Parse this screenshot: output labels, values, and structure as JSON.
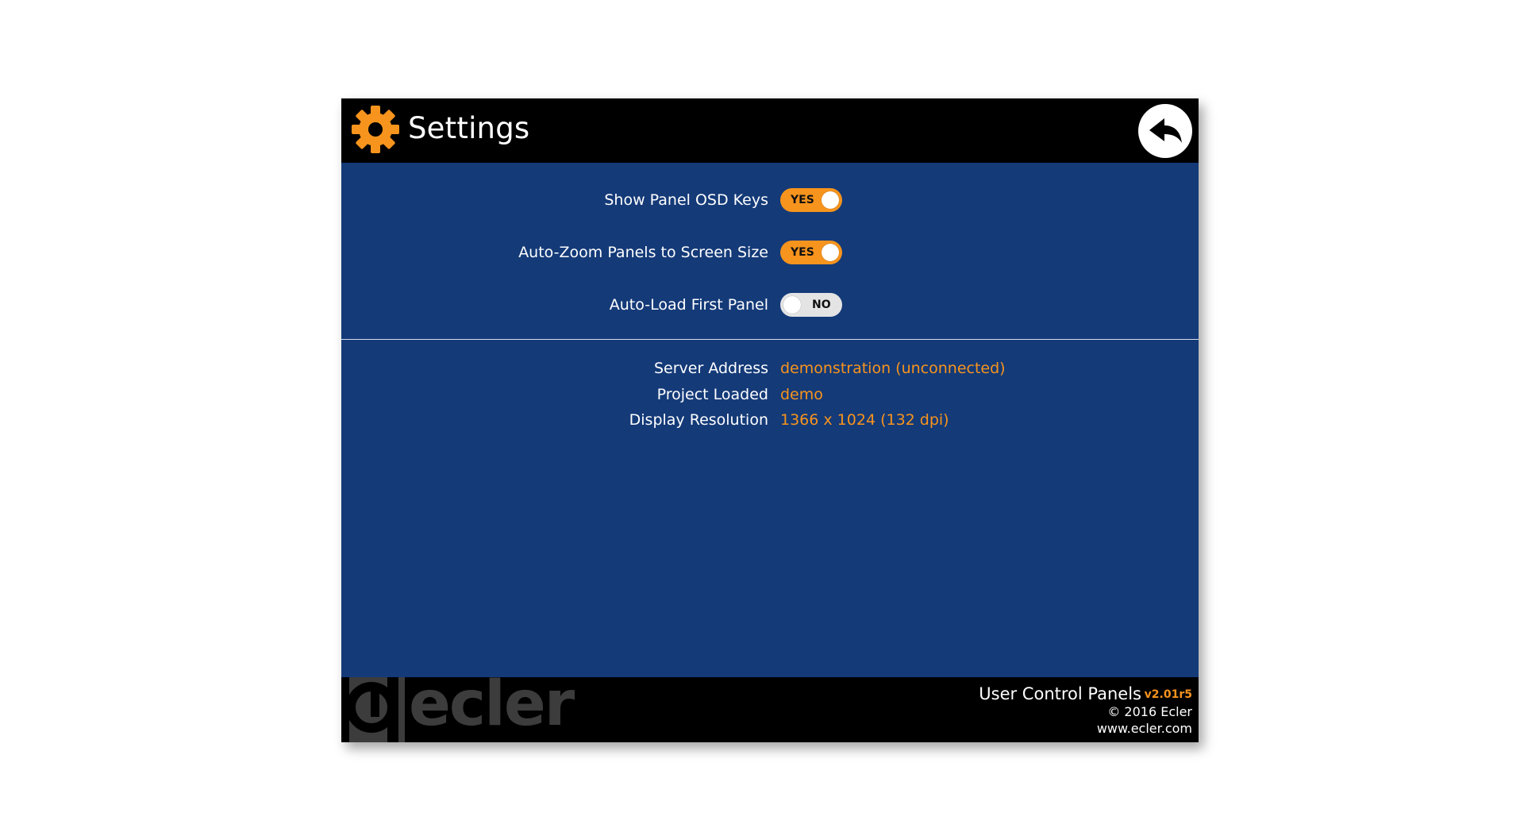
{
  "header": {
    "title": "Settings",
    "icon": "gear-icon",
    "back_icon": "back-arrow-icon"
  },
  "options": [
    {
      "label": "Show Panel OSD Keys",
      "state": "YES",
      "enabled": true
    },
    {
      "label": "Auto-Zoom Panels to Screen Size",
      "state": "YES",
      "enabled": true
    },
    {
      "label": "Auto-Load First Panel",
      "state": "NO",
      "enabled": false
    }
  ],
  "info": [
    {
      "label": "Server Address",
      "value": "demonstration (unconnected)"
    },
    {
      "label": "Project Loaded",
      "value": "demo"
    },
    {
      "label": "Display Resolution",
      "value": "1366 x 1024 (132 dpi)"
    }
  ],
  "footer": {
    "logo_text": "ecler",
    "app_name": "User Control Panels",
    "version": "v2.01r5",
    "copyright": "© 2016 Ecler",
    "website": "www.ecler.com"
  },
  "colors": {
    "accent": "#f7941d",
    "background": "#143a78",
    "bar": "#000000",
    "toggle_off": "#e4e4e4"
  }
}
